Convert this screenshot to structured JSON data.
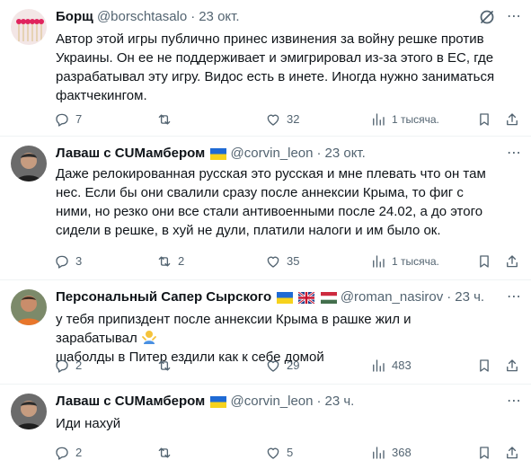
{
  "tweets": [
    {
      "author": "Борщ",
      "handle": "@borschtasalo",
      "time": "23 окт.",
      "text": [
        "Автор этой игры публично принес извинения за войну решке против Украины. Он ее не поддерживает и эмигрировал из-за этого в ЕС, где разрабатывал эту игру. Видос есть в инете. Иногда нужно заниматься фактчекингом."
      ],
      "stats": {
        "replies": "7",
        "reposts": "",
        "likes": "32",
        "views": "1 тысяча."
      },
      "avatar": "matches-avatar",
      "flags": []
    },
    {
      "author": "Лаваш с CUМамбером",
      "handle": "@corvin_leon",
      "time": "23 окт.",
      "text": [
        "Даже релокированная русская это русская и мне плевать что он там нес. Если бы они свалили сразу после аннексии Крыма, то фиг с ними, но резко они все стали антивоенными после 24.02, а до этого сидели в решке, в хуй не дули, платили налоги и им было ок."
      ],
      "stats": {
        "replies": "3",
        "reposts": "2",
        "likes": "35",
        "views": "1 тысяча."
      },
      "avatar": "person-dark-avatar",
      "flags": [
        "ukraine-flag"
      ]
    },
    {
      "author": "Персональный Сапер Сырского",
      "handle": "@roman_nasirov",
      "time": "23 ч.",
      "text": [
        "у тебя припиздент после аннексии Крыма в рашке жил и зарабатывал",
        "шаболды в Питер ездили как к себе домой"
      ],
      "stats": {
        "replies": "2",
        "reposts": "",
        "likes": "29",
        "views": "483"
      },
      "avatar": "person-orange-avatar",
      "flags": [
        "ukraine-flag",
        "uk-flag",
        "hungary-flag"
      ]
    },
    {
      "author": "Лаваш с CUМамбером",
      "handle": "@corvin_leon",
      "time": "23 ч.",
      "text": [
        "Иди нахуй"
      ],
      "stats": {
        "replies": "2",
        "reposts": "",
        "likes": "5",
        "views": "368"
      },
      "avatar": "person-dark-avatar",
      "flags": [
        "ukraine-flag"
      ]
    }
  ],
  "colors": {
    "text": "#0f1419",
    "muted": "#536471",
    "divider": "#eff3f4"
  }
}
